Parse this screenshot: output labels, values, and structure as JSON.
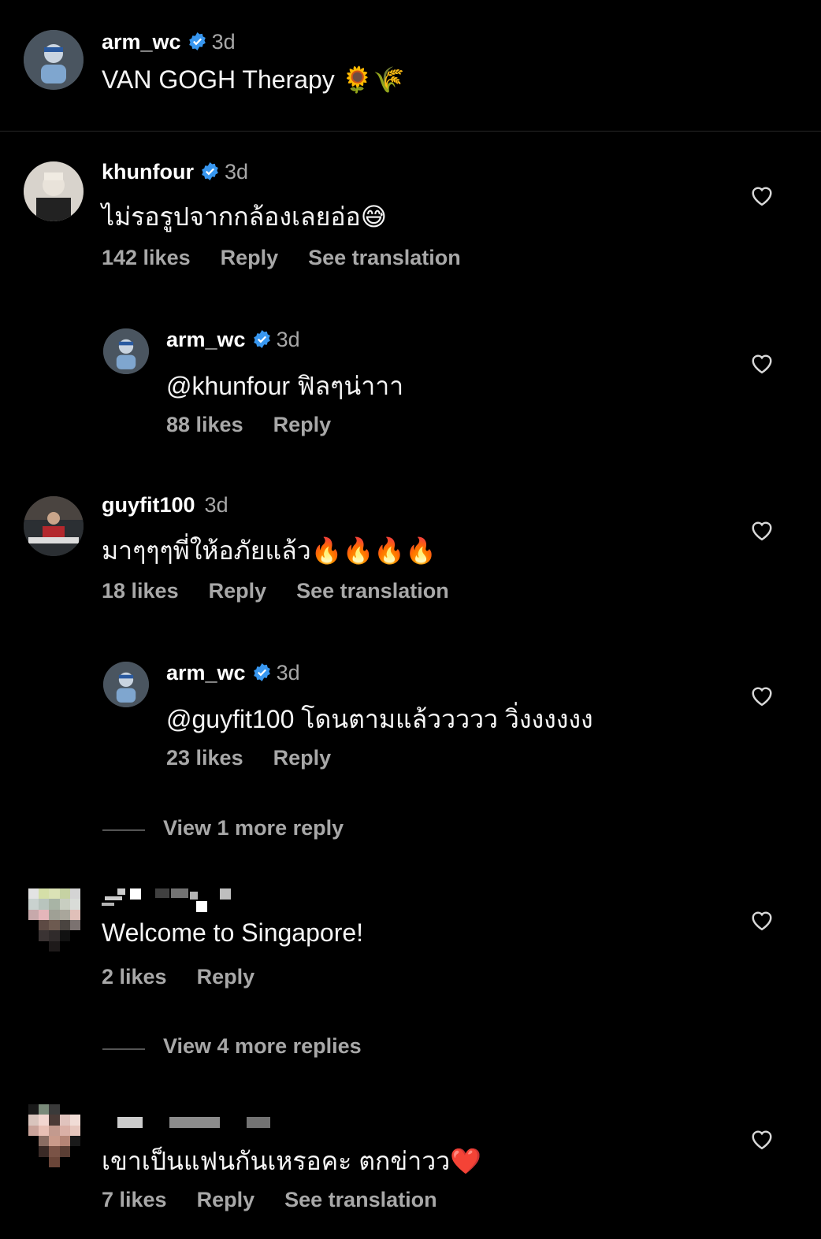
{
  "caption": {
    "username": "arm_wc",
    "time": "3d",
    "text": "VAN GOGH Therapy 🌻🌾"
  },
  "comments": [
    {
      "username": "khunfour",
      "time": "3d",
      "text": "ไม่รอรูปจากกล้องเลยอ่อ😅",
      "likes": "142 likes",
      "reply": "Reply",
      "translate": "See translation"
    },
    {
      "username": "arm_wc",
      "time": "3d",
      "text": "@khunfour ฟิลๆน่าาา",
      "likes": "88 likes",
      "reply": "Reply"
    },
    {
      "username": "guyfit100",
      "time": "3d",
      "text": "มาๆๆๆพี่ให้อภัยแล้ว🔥🔥🔥🔥",
      "likes": "18 likes",
      "reply": "Reply",
      "translate": "See translation"
    },
    {
      "username": "arm_wc",
      "time": "3d",
      "text": "@guyfit100 โดนตามแล้ววววว วิ่งงงงงง",
      "likes": "23 likes",
      "reply": "Reply"
    },
    {
      "text": "Welcome to Singapore!",
      "likes": "2 likes",
      "reply": "Reply"
    },
    {
      "text": "เขาเป็นแฟนกันเหรอคะ ตกข่าวว❤️",
      "likes": "7 likes",
      "reply": "Reply",
      "translate": "See translation"
    }
  ],
  "view_more": {
    "one": "View 1 more reply",
    "four": "View 4 more replies"
  },
  "colors": {
    "background": "#000000",
    "verified": "#3897f0",
    "muted": "#a8a8a8"
  },
  "icons": [
    "verified-badge-icon",
    "heart-outline-icon"
  ]
}
